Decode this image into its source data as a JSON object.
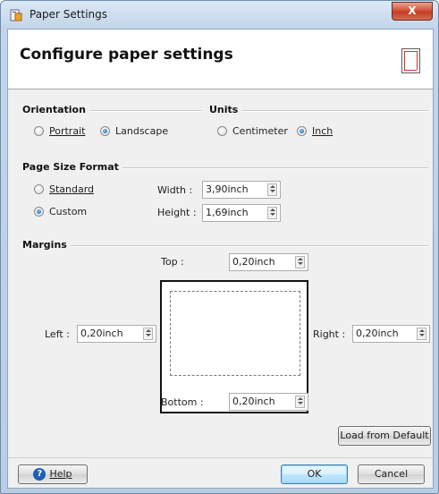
{
  "window": {
    "title": "Paper Settings",
    "close_label": "X"
  },
  "header": {
    "title": "Configure paper settings"
  },
  "orientation": {
    "title": "Orientation",
    "options": [
      {
        "label": "Portrait",
        "selected": false
      },
      {
        "label": "Landscape",
        "selected": true
      }
    ]
  },
  "units": {
    "title": "Units",
    "options": [
      {
        "label": "Centimeter",
        "selected": false
      },
      {
        "label": "Inch",
        "selected": true
      }
    ]
  },
  "page_size": {
    "title": "Page Size Format",
    "options": [
      {
        "label": "Standard",
        "selected": false
      },
      {
        "label": "Custom",
        "selected": true
      }
    ],
    "width_label": "Width :",
    "width_value": "3,90inch",
    "height_label": "Height :",
    "height_value": "1,69inch"
  },
  "margins": {
    "title": "Margins",
    "top_label": "Top :",
    "top_value": "0,20inch",
    "left_label": "Left :",
    "left_value": "0,20inch",
    "right_label": "Right :",
    "right_value": "0,20inch",
    "bottom_label": "Bottom :",
    "bottom_value": "0,20inch"
  },
  "buttons": {
    "load_default": "Load from Default",
    "help": "Help",
    "ok": "OK",
    "cancel": "Cancel"
  },
  "colors": {
    "accent": "#1f5ea8",
    "preview_border": "#111111"
  }
}
